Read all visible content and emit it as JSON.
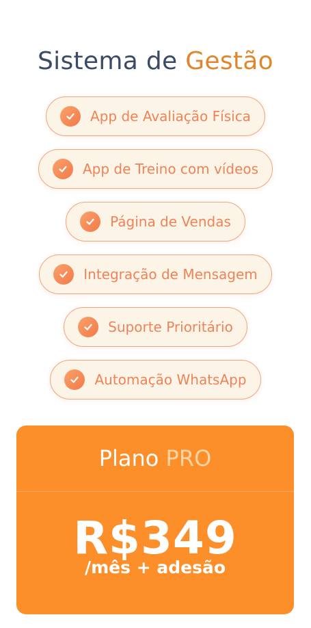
{
  "header": {
    "title_prefix": "Sistema de",
    "title_accent": "Gestão"
  },
  "features": [
    {
      "label": "App de Avaliação Física",
      "icon": "check-circle-icon"
    },
    {
      "label": "App de Treino com vídeos",
      "icon": "check-circle-icon"
    },
    {
      "label": "Página de Vendas",
      "icon": "check-circle-icon"
    },
    {
      "label": "Integração de Mensagem",
      "icon": "check-circle-icon"
    },
    {
      "label": "Suporte Prioritário",
      "icon": "check-circle-icon"
    },
    {
      "label": "Automação WhatsApp",
      "icon": "check-circle-icon"
    }
  ],
  "plan": {
    "name_prefix": "Plano",
    "name_accent": "PRO",
    "price": "R$349",
    "price_note": "/mês + adesão"
  },
  "colors": {
    "title": "#3b4a66",
    "accent": "#e0862c",
    "pill_border": "#f3a37b",
    "pill_background": "#fdf4e8",
    "pill_text": "#ef8358",
    "plan_background": "#fd8f2a",
    "plan_accent": "#fbd5a7"
  }
}
